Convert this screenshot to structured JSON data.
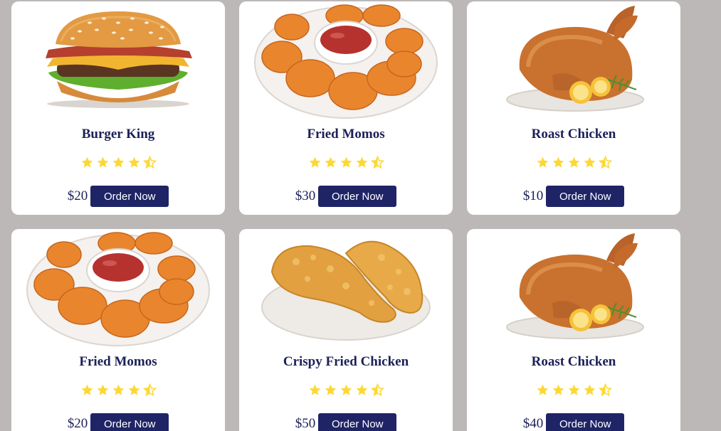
{
  "menu": {
    "items": [
      {
        "title": "Burger King",
        "price": "$20",
        "order_label": "Order Now",
        "rating": 4.5,
        "image_icon": "burger-image"
      },
      {
        "title": "Fried Momos",
        "price": "$30",
        "order_label": "Order Now",
        "rating": 4.5,
        "image_icon": "nuggets-image"
      },
      {
        "title": "Roast Chicken",
        "price": "$10",
        "order_label": "Order Now",
        "rating": 4.5,
        "image_icon": "roast-chicken-image"
      },
      {
        "title": "Fried Momos",
        "price": "$20",
        "order_label": "Order Now",
        "rating": 4.5,
        "image_icon": "nuggets-image"
      },
      {
        "title": "Crispy Fried Chicken",
        "price": "$50",
        "order_label": "Order Now",
        "rating": 4.5,
        "image_icon": "fried-chicken-image"
      },
      {
        "title": "Roast Chicken",
        "price": "$40",
        "order_label": "Order Now",
        "rating": 4.5,
        "image_icon": "roast-chicken-image"
      }
    ]
  },
  "colors": {
    "page_background": "#bcb8b8",
    "card_background": "#ffffff",
    "title_text": "#1c2058",
    "button_background": "#1f2467",
    "button_text": "#ffffff",
    "star_fill": "#fdd835"
  }
}
